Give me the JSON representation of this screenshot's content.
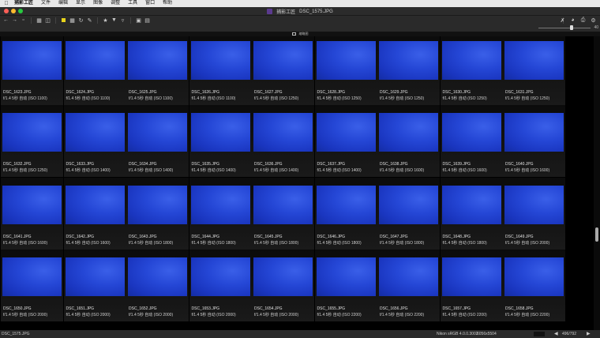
{
  "menubar": {
    "apple": "",
    "items": [
      "捕影工匠",
      "文件",
      "编辑",
      "显示",
      "图像",
      "调整",
      "工具",
      "窗口",
      "帮助"
    ]
  },
  "window": {
    "app_name": "捕影工匠",
    "title": "DSC_1575.JPG"
  },
  "toolbar": {
    "icons": [
      "back-arrow-icon",
      "forward-arrow-icon",
      "folder-icon",
      "grid-view-icon",
      "compare-view-icon",
      "color-label-icon",
      "rotate-icon",
      "star-icon",
      "filter-icon",
      "sort-icon",
      "edit-icon"
    ],
    "right_icons": [
      "metadata-icon",
      "print-icon",
      "share-icon"
    ]
  },
  "zoom": {
    "label": "40"
  },
  "tab": {
    "label": "缩略图"
  },
  "thumbnails": [
    {
      "name": "DSC_1623.JPG",
      "meta": "f/1.4 5秒  自动  (ISO 1100)"
    },
    {
      "name": "DSC_1624.JPG",
      "meta": "f/1.4 5秒  自动  (ISO 1100)"
    },
    {
      "name": "DSC_1625.JPG",
      "meta": "f/1.4 5秒  自动  (ISO 1100)"
    },
    {
      "name": "DSC_1626.JPG",
      "meta": "f/1.4 5秒  自动  (ISO 1100)"
    },
    {
      "name": "DSC_1627.JPG",
      "meta": "f/1.4 5秒  自动  (ISO 1250)"
    },
    {
      "name": "DSC_1628.JPG",
      "meta": "f/1.4 5秒  自动  (ISO 1250)"
    },
    {
      "name": "DSC_1629.JPG",
      "meta": "f/1.4 5秒  自动  (ISO 1250)"
    },
    {
      "name": "DSC_1630.JPG",
      "meta": "f/1.4 5秒  自动  (ISO 1250)"
    },
    {
      "name": "DSC_1631.JPG",
      "meta": "f/1.4 5秒  自动  (ISO 1250)"
    },
    {
      "name": "DSC_1632.JPG",
      "meta": "f/1.4 5秒  自动  (ISO 1250)"
    },
    {
      "name": "DSC_1633.JPG",
      "meta": "f/1.4 5秒  自动  (ISO 1400)"
    },
    {
      "name": "DSC_1634.JPG",
      "meta": "f/1.4 5秒  自动  (ISO 1400)"
    },
    {
      "name": "DSC_1635.JPG",
      "meta": "f/1.4 5秒  自动  (ISO 1400)"
    },
    {
      "name": "DSC_1636.JPG",
      "meta": "f/1.4 5秒  自动  (ISO 1400)"
    },
    {
      "name": "DSC_1637.JPG",
      "meta": "f/1.4 5秒  自动  (ISO 1400)"
    },
    {
      "name": "DSC_1638.JPG",
      "meta": "f/1.4 5秒  自动  (ISO 1600)"
    },
    {
      "name": "DSC_1639.JPG",
      "meta": "f/1.4 5秒  自动  (ISO 1600)"
    },
    {
      "name": "DSC_1640.JPG",
      "meta": "f/1.4 5秒  自动  (ISO 1600)"
    },
    {
      "name": "DSC_1641.JPG",
      "meta": "f/1.4 5秒  自动  (ISO 1600)"
    },
    {
      "name": "DSC_1642.JPG",
      "meta": "f/1.4 5秒  自动  (ISO 1600)"
    },
    {
      "name": "DSC_1643.JPG",
      "meta": "f/1.4 5秒  自动  (ISO 1800)"
    },
    {
      "name": "DSC_1644.JPG",
      "meta": "f/1.4 5秒  自动  (ISO 1800)"
    },
    {
      "name": "DSC_1645.JPG",
      "meta": "f/1.4 5秒  自动  (ISO 1800)"
    },
    {
      "name": "DSC_1646.JPG",
      "meta": "f/1.4 5秒  自动  (ISO 1800)"
    },
    {
      "name": "DSC_1647.JPG",
      "meta": "f/1.4 5秒  自动  (ISO 1800)"
    },
    {
      "name": "DSC_1648.JPG",
      "meta": "f/1.4 5秒  自动  (ISO 1800)"
    },
    {
      "name": "DSC_1649.JPG",
      "meta": "f/1.4 5秒  自动  (ISO 2000)"
    },
    {
      "name": "DSC_1650.JPG",
      "meta": "f/1.4 5秒  自动  (ISO 2000)"
    },
    {
      "name": "DSC_1651.JPG",
      "meta": "f/1.4 5秒  自动  (ISO 2000)"
    },
    {
      "name": "DSC_1652.JPG",
      "meta": "f/1.4 5秒  自动  (ISO 2000)"
    },
    {
      "name": "DSC_1653.JPG",
      "meta": "f/1.4 5秒  自动  (ISO 2000)"
    },
    {
      "name": "DSC_1654.JPG",
      "meta": "f/1.4 5秒  自动  (ISO 2000)"
    },
    {
      "name": "DSC_1655.JPG",
      "meta": "f/1.4 5秒  自动  (ISO 2200)"
    },
    {
      "name": "DSC_1656.JPG",
      "meta": "f/1.4 5秒  自动  (ISO 2200)"
    },
    {
      "name": "DSC_1657.JPG",
      "meta": "f/1.4 5秒  自动  (ISO 2200)"
    },
    {
      "name": "DSC_1658.JPG",
      "meta": "f/1.4 5秒  自动  (ISO 2200)"
    }
  ],
  "status": {
    "selected_file": "DSC_1575.JPG",
    "color_profile": "Nikon sRGB 4.0.0.3002",
    "dimensions": "6056x5504",
    "count": "496/792"
  },
  "colors": {
    "thumbnail_blue": "#2547d6",
    "label_yellow": "#e7d31c"
  }
}
